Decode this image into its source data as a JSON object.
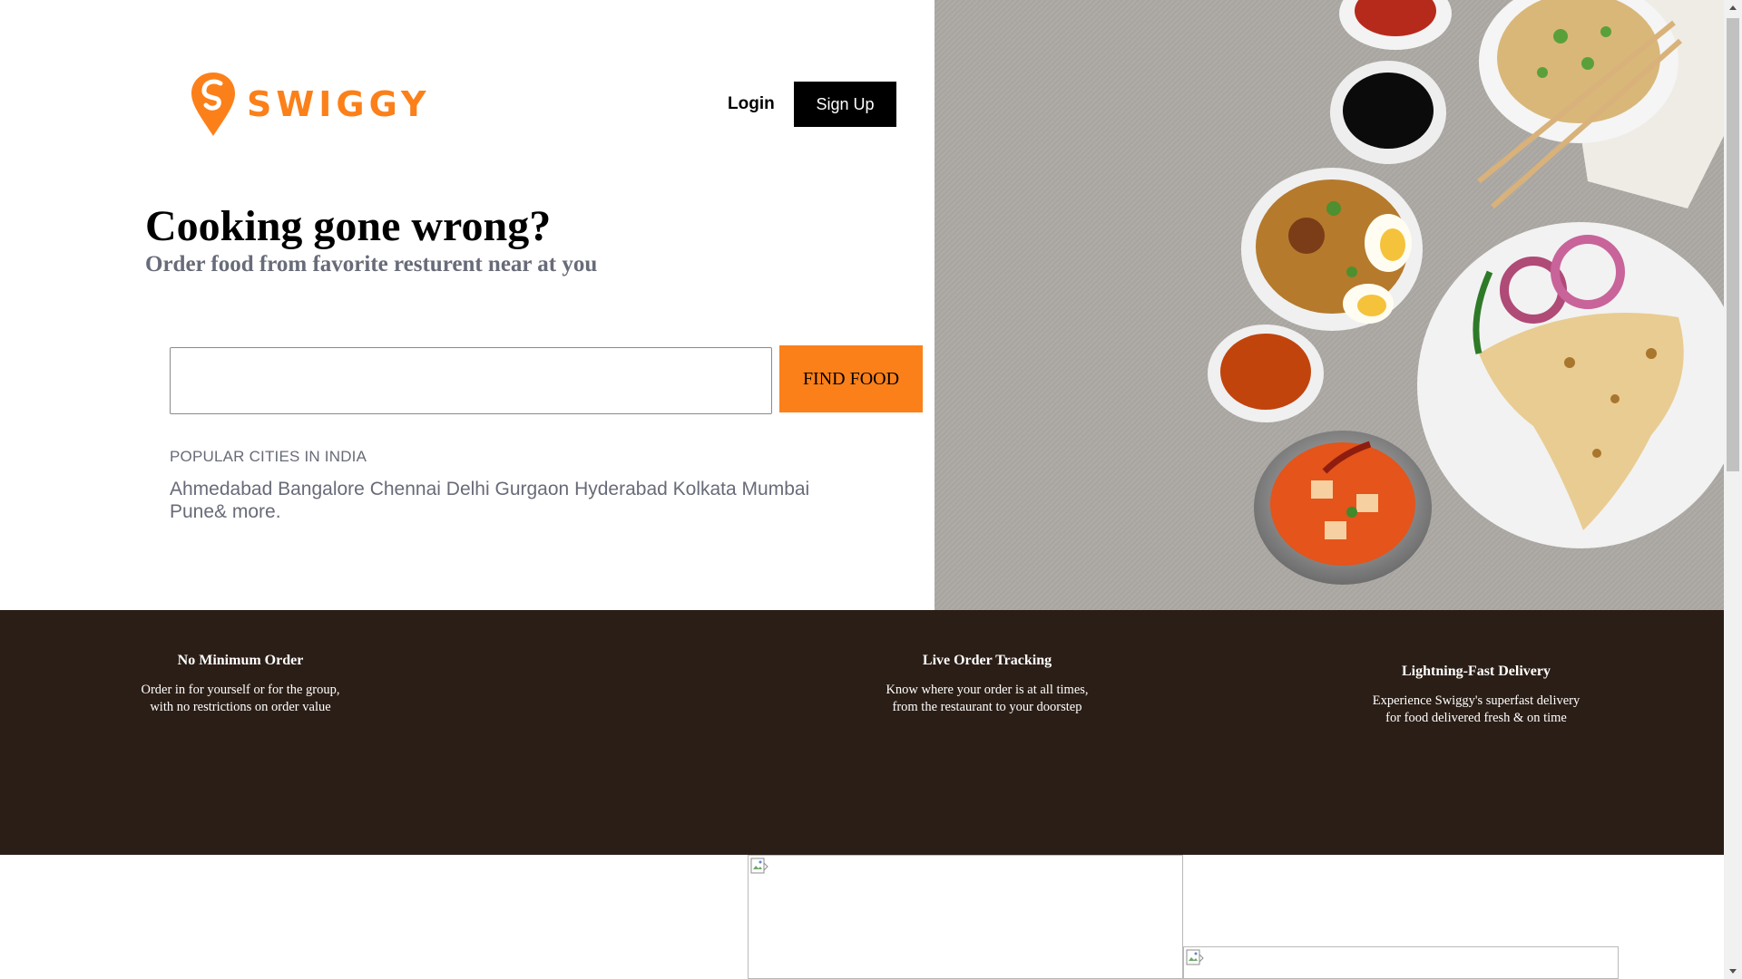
{
  "header": {
    "brand": "SWIGGY",
    "login_label": "Login",
    "signup_label": "Sign Up"
  },
  "hero": {
    "title": "Cooking gone wrong?",
    "subtitle": "Order food from favorite resturent near at you",
    "search": {
      "value": "",
      "placeholder": ""
    },
    "find_food_label": "FIND FOOD",
    "cities_heading": "POPULAR CITIES IN INDIA",
    "cities": [
      "Ahmedabad",
      "Bangalore",
      "Chennai",
      "Delhi",
      "Gurgaon",
      "Hyderabad",
      "Kolkata",
      "Mumbai",
      "Pune"
    ],
    "more_label": "& more."
  },
  "features": [
    {
      "title": "No Minimum Order",
      "desc_line1": "Order in for yourself or for the group,",
      "desc_line2": "with no restrictions on order value"
    },
    {
      "title": "Live Order Tracking",
      "desc_line1": "Know where your order is at all times,",
      "desc_line2": "from the restaurant to your doorstep"
    },
    {
      "title": "Lightning-Fast Delivery",
      "desc_line1": "Experience Swiggy's superfast delivery",
      "desc_line2": "for food delivered fresh & on time"
    }
  ],
  "colors": {
    "brand_orange": "#fc8019",
    "features_bg": "#2b1e16",
    "muted_text": "#686b78"
  },
  "icons": [
    "swiggy-pin-icon",
    "broken-image-icon",
    "scroll-up-arrow-icon",
    "scroll-down-arrow-icon"
  ]
}
